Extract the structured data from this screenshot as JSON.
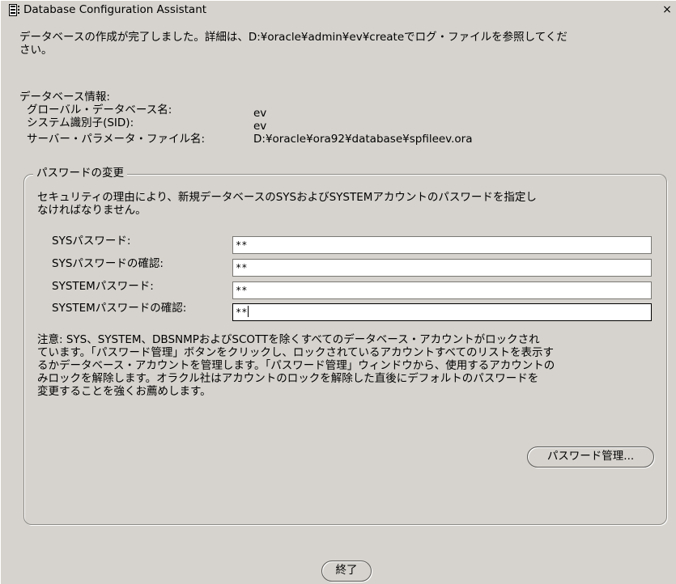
{
  "window": {
    "title": "Database Configuration Assistant",
    "close_label": "×"
  },
  "message": {
    "line1": "データベースの作成が完了しました。詳細は、D:¥oracle¥admin¥ev¥createでログ・ファイルを参照してくだ",
    "line2": "さい。"
  },
  "db_info": {
    "heading": "データベース情報:",
    "rows": [
      {
        "label": "グローバル・データベース名:",
        "value": "ev"
      },
      {
        "label": "システム識別子(SID):",
        "value": "ev"
      },
      {
        "label": "サーバー・パラメータ・ファイル名:",
        "value": "D:¥oracle¥ora92¥database¥spfileev.ora"
      }
    ]
  },
  "password_group": {
    "legend": "パスワードの変更",
    "description": [
      "セキュリティの理由により、新規データベースのSYSおよびSYSTEMアカウントのパスワードを指定し",
      "なければなりません。"
    ],
    "fields": [
      {
        "label": "SYSパスワード:",
        "value": "**"
      },
      {
        "label": "SYSパスワードの確認:",
        "value": "**"
      },
      {
        "label": "SYSTEMパスワード:",
        "value": "**"
      },
      {
        "label": "SYSTEMパスワードの確認:",
        "value": "**"
      }
    ],
    "note": [
      "注意: SYS、SYSTEM、DBSNMPおよびSCOTTを除くすべてのデータベース・アカウントがロックされ",
      "ています。「パスワード管理」ボタンをクリックし、ロックされているアカウントすべてのリストを表示す",
      "るかデータベース・アカウントを管理します。「パスワード管理」ウィンドウから、使用するアカウントの",
      "みロックを解除します。オラクル社はアカウントのロックを解除した直後にデフォルトのパスワードを",
      "変更することを強くお薦めします。"
    ],
    "manage_button": "パスワード管理..."
  },
  "exit_button": "終了"
}
